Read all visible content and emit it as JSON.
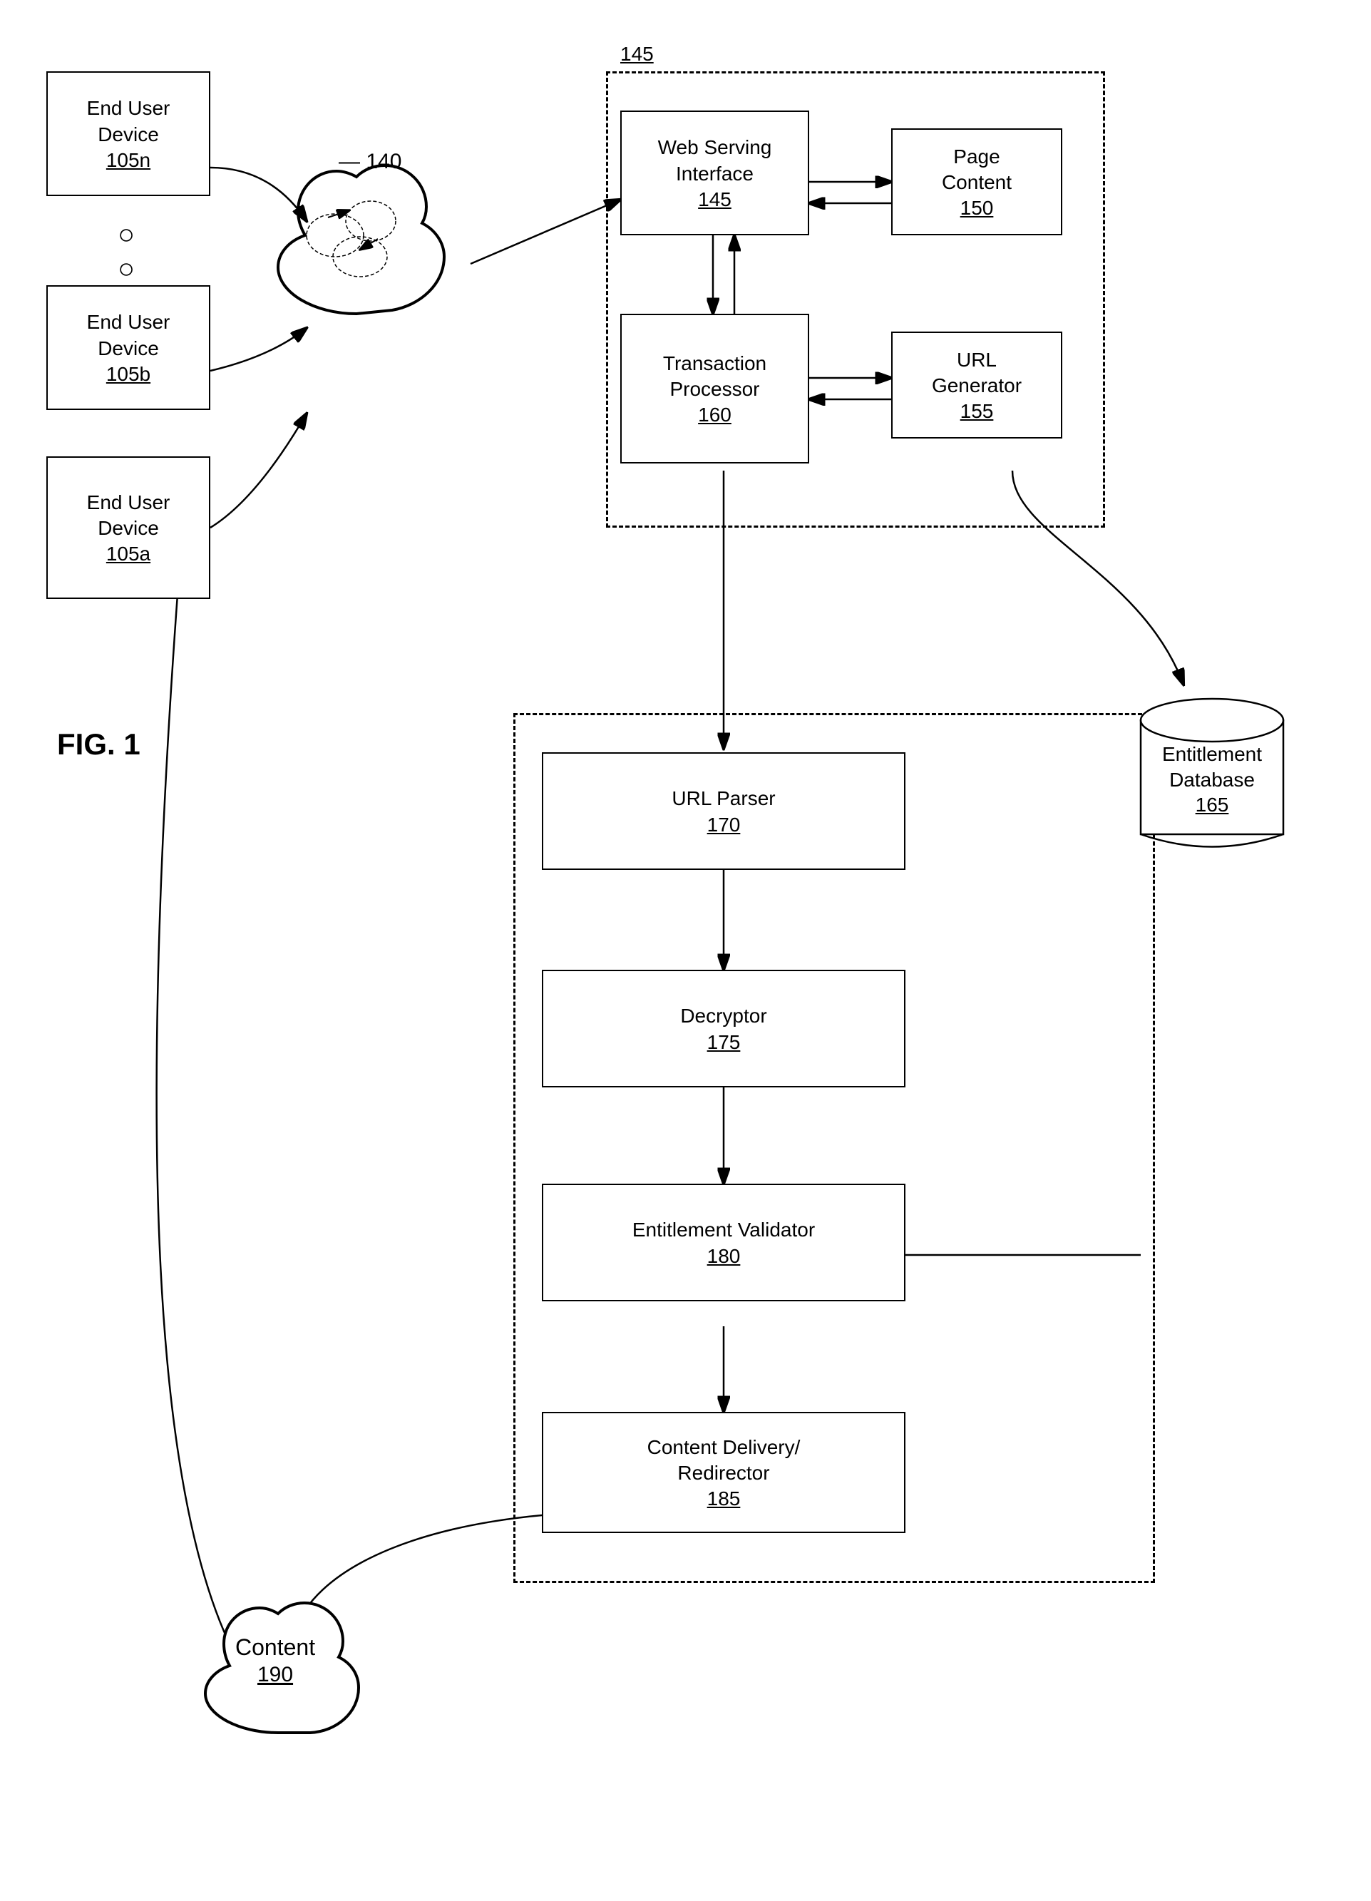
{
  "figure": {
    "label": "FIG. 1"
  },
  "components": {
    "end_user_device_n": {
      "label": "End User\nDevice",
      "number": "105n"
    },
    "end_user_device_b": {
      "label": "End User\nDevice",
      "number": "105b"
    },
    "end_user_device_a": {
      "label": "End User\nDevice",
      "number": "105a"
    },
    "network": {
      "number": "140"
    },
    "server_group": {
      "number": "145"
    },
    "web_serving_interface": {
      "label": "Web Serving\nInterface",
      "number": "145"
    },
    "page_content": {
      "label": "Page\nContent",
      "number": "150"
    },
    "transaction_processor": {
      "label": "Transaction\nProcessor",
      "number": "160"
    },
    "url_generator": {
      "label": "URL\nGenerator",
      "number": "155"
    },
    "url_parser": {
      "label": "URL Parser",
      "number": "170"
    },
    "decryptor": {
      "label": "Decryptor",
      "number": "175"
    },
    "entitlement_validator": {
      "label": "Entitlement Validator",
      "number": "180"
    },
    "content_delivery": {
      "label": "Content Delivery/\nRedirector",
      "number": "185"
    },
    "entitlement_database": {
      "label": "Entitlement\nDatabase",
      "number": "165"
    },
    "content": {
      "label": "Content",
      "number": "190"
    }
  }
}
